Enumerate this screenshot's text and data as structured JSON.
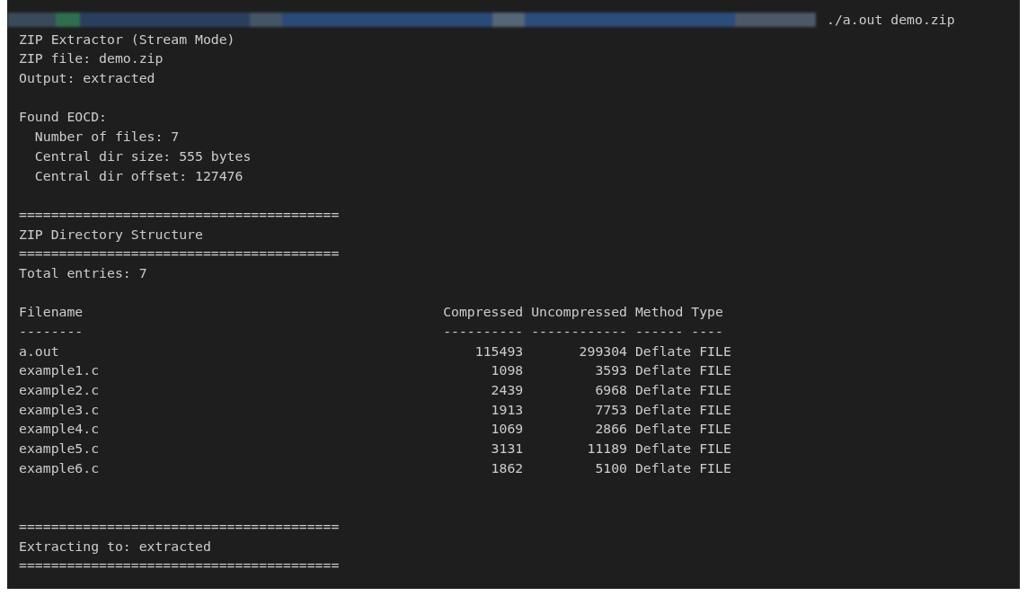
{
  "prompt": {
    "command": "./a.out demo.zip"
  },
  "output": [
    {
      "kind": "text",
      "text": "ZIP Extractor (Stream Mode)"
    },
    {
      "kind": "text",
      "text": "ZIP file: demo.zip"
    },
    {
      "kind": "text",
      "text": "Output: extracted"
    },
    {
      "kind": "blank"
    },
    {
      "kind": "text",
      "text": "Found EOCD:"
    },
    {
      "kind": "indented",
      "text": "Number of files: 7"
    },
    {
      "kind": "indented",
      "text": "Central dir size: 555 bytes"
    },
    {
      "kind": "indented",
      "text": "Central dir offset: 127476"
    },
    {
      "kind": "blank"
    },
    {
      "kind": "rule",
      "text": "========================================"
    },
    {
      "kind": "text",
      "text": "ZIP Directory Structure"
    },
    {
      "kind": "rule",
      "text": "========================================"
    },
    {
      "kind": "text",
      "text": "Total entries: 7"
    },
    {
      "kind": "blank"
    },
    {
      "kind": "table",
      "columns": [
        "Filename",
        "Compressed",
        "Uncompressed",
        "Method",
        "Type"
      ],
      "underlines": [
        "--------",
        "----------",
        "------------",
        "------",
        "----"
      ],
      "rows": [
        [
          "a.out",
          "115493",
          "299304",
          "Deflate",
          "FILE"
        ],
        [
          "example1.c",
          "1098",
          "3593",
          "Deflate",
          "FILE"
        ],
        [
          "example2.c",
          "2439",
          "6968",
          "Deflate",
          "FILE"
        ],
        [
          "example3.c",
          "1913",
          "7753",
          "Deflate",
          "FILE"
        ],
        [
          "example4.c",
          "1069",
          "2866",
          "Deflate",
          "FILE"
        ],
        [
          "example5.c",
          "3131",
          "11189",
          "Deflate",
          "FILE"
        ],
        [
          "example6.c",
          "1862",
          "5100",
          "Deflate",
          "FILE"
        ]
      ]
    },
    {
      "kind": "blank"
    },
    {
      "kind": "blank"
    },
    {
      "kind": "rule",
      "text": "========================================"
    },
    {
      "kind": "text",
      "text": "Extracting to: extracted"
    },
    {
      "kind": "rule",
      "text": "========================================"
    }
  ]
}
